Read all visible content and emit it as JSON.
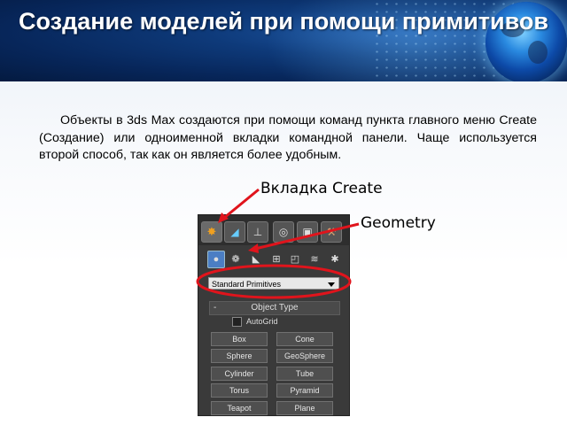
{
  "slide": {
    "title": "Создание моделей при помощи примитивов",
    "paragraph": "Объекты в 3ds Max создаются при помощи команд пункта главного меню Create (Создание) или одноименной вкладки командной панели. Чаще используется второй способ, так как он является более удобным."
  },
  "callouts": {
    "create_tab": "Вкладка Create",
    "geometry": "Geometry"
  },
  "panel": {
    "tabs": [
      {
        "icon": "create-icon"
      },
      {
        "icon": "modify-icon"
      },
      {
        "icon": "hierarchy-icon"
      },
      {
        "icon": "motion-icon"
      },
      {
        "icon": "display-icon"
      },
      {
        "icon": "utilities-icon"
      }
    ],
    "subtabs": [
      {
        "icon": "geometry-icon"
      },
      {
        "icon": "shapes-icon"
      },
      {
        "icon": "lights-icon"
      },
      {
        "icon": "cameras-icon"
      },
      {
        "icon": "helpers-icon"
      },
      {
        "icon": "space-warps-icon"
      },
      {
        "icon": "systems-icon"
      }
    ],
    "dropdown_value": "Standard Primitives",
    "rollout_title": "Object Type",
    "rollout_toggle": "-",
    "autogrid_label": "AutoGrid",
    "buttons": [
      [
        "Box",
        "Cone"
      ],
      [
        "Sphere",
        "GeoSphere"
      ],
      [
        "Cylinder",
        "Tube"
      ],
      [
        "Torus",
        "Pyramid"
      ],
      [
        "Teapot",
        "Plane"
      ]
    ]
  },
  "colors": {
    "highlight_red": "#e0141c",
    "panel_bg": "#3a3a3a"
  }
}
